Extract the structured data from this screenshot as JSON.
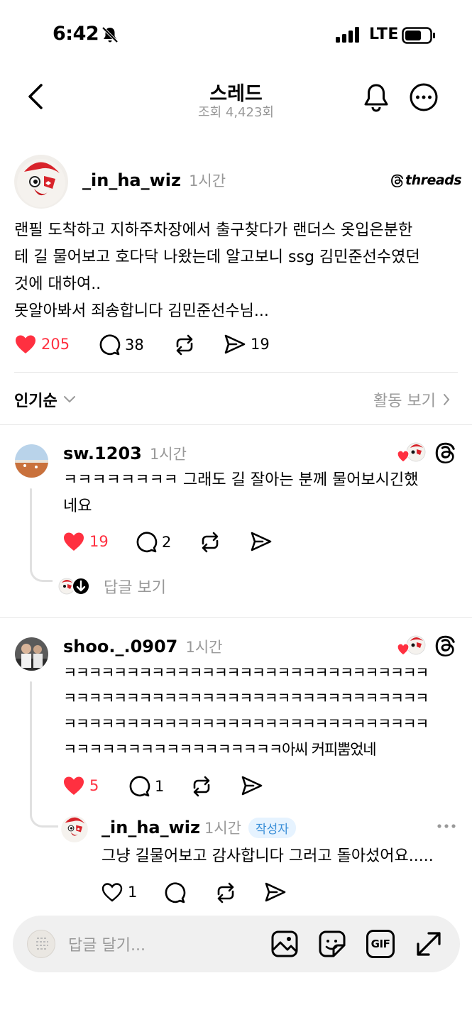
{
  "status_bar": {
    "time": "6:42",
    "network": "LTE",
    "icons": [
      "bell-slash-icon",
      "signal-icon",
      "battery-icon"
    ]
  },
  "nav": {
    "title": "스레드",
    "views": "조회 4,423회",
    "icons": [
      "back-icon",
      "bell-icon",
      "more-icon"
    ]
  },
  "post": {
    "username": "_in_ha_wiz",
    "time": "1시간",
    "brand": "threads",
    "lines": [
      "랜필 도착하고 지하주차장에서 출구찾다가 랜더스 옷입은분한",
      "테 길 물어보고 호다닥 나왔는데 알고보니 ssg 김민준선수였던",
      "것에 대하여..",
      "못알아봐서 죄송합니다 김민준선수님..."
    ],
    "likes": "205",
    "comments": "38",
    "shares": "19"
  },
  "sort": {
    "label": "인기순",
    "activity": "활동 보기"
  },
  "replies": [
    {
      "username": "sw.1203",
      "time": "1시간",
      "lines": [
        "ㅋㅋㅋㅋㅋㅋㅋㅋ 그래도 길 잘아는 분께 물어보시긴했",
        "네요"
      ],
      "likes": "19",
      "comments": "2",
      "view_replies": "답글 보기"
    },
    {
      "username": "shoo._.0907",
      "time": "1시간",
      "lines": [
        "ㅋㅋㅋㅋㅋㅋㅋㅋㅋㅋㅋㅋㅋㅋㅋㅋㅋㅋㅋㅋㅋㅋㅋㅋㅋㅋㅋㅋㅋ",
        "ㅋㅋㅋㅋㅋㅋㅋㅋㅋㅋㅋㅋㅋㅋㅋㅋㅋㅋㅋㅋㅋㅋㅋㅋㅋㅋㅋㅋㅋ",
        "ㅋㅋㅋㅋㅋㅋㅋㅋㅋㅋㅋㅋㅋㅋㅋㅋㅋㅋㅋㅋㅋㅋㅋㅋㅋㅋㅋㅋㅋ",
        "ㅋㅋㅋㅋㅋㅋㅋㅋㅋㅋㅋㅋㅋㅋㅋㅋㅋ아씨 커피뿜었네"
      ],
      "likes": "5",
      "nested": {
        "username": "_in_ha_wiz",
        "time": "1시간",
        "badge": "작성자",
        "text": "그냥 길물어보고 감사합니다 그러고 돌아섰어요.....",
        "likes": "1"
      }
    }
  ],
  "composer": {
    "placeholder": "답글 달기...",
    "icons": [
      "image-icon",
      "sticker-icon",
      "gif-icon",
      "expand-icon"
    ],
    "gif_label": "GIF"
  },
  "colors": {
    "like_red": "#ff3040",
    "muted": "#999999",
    "author_badge": "#3b8fd8"
  }
}
